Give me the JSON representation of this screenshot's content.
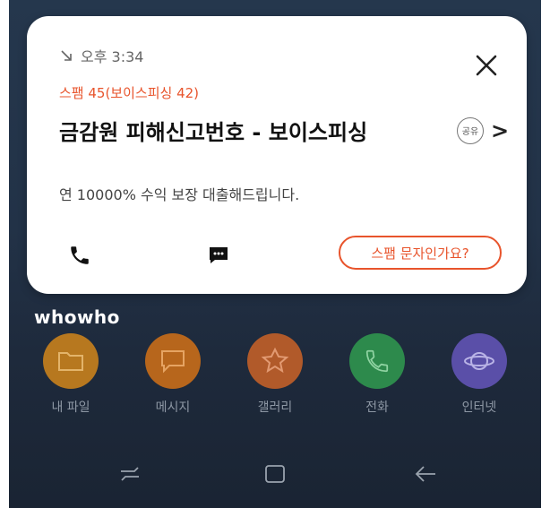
{
  "notification": {
    "time": "오후 3:34",
    "spam_count": "스팸 45(보이스피싱 42)",
    "title": "금감원 피해신고번호 - 보이스피싱",
    "share_label": "공유",
    "chevron": ">",
    "message": "연 10000% 수익 보장 대출해드립니다.",
    "spam_question_button": "스팸 문자인가요?"
  },
  "brand": "whowho",
  "apps": [
    {
      "label": "내 파일",
      "color": "#b7781f",
      "icon": "folder-icon"
    },
    {
      "label": "메시지",
      "color": "#b7661c",
      "icon": "message-icon"
    },
    {
      "label": "갤러리",
      "color": "#b15a2a",
      "icon": "gallery-flower-icon"
    },
    {
      "label": "전화",
      "color": "#2d8a4c",
      "icon": "phone-icon"
    },
    {
      "label": "인터넷",
      "color": "#5a4fa8",
      "icon": "planet-icon"
    }
  ],
  "colors": {
    "accent": "#e8542c",
    "card_bg": "#ffffff",
    "wallpaper_top": "#25374d",
    "wallpaper_bottom": "#1a2433"
  },
  "nav": [
    "recents-icon",
    "home-icon",
    "back-icon"
  ]
}
